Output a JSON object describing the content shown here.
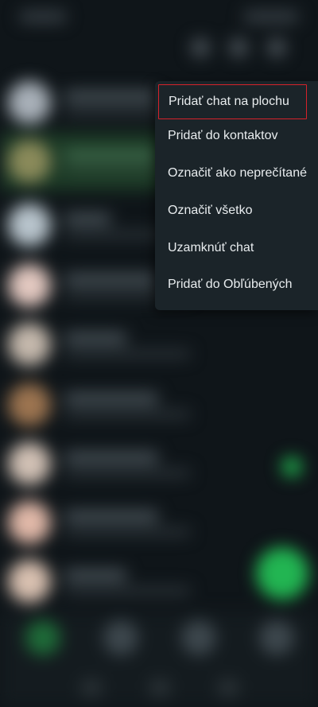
{
  "context_menu": {
    "items": [
      {
        "label": "Pridať chat na plochu"
      },
      {
        "label": "Pridať do kontaktov"
      },
      {
        "label": "Označiť ako neprečítané"
      },
      {
        "label": "Označiť všetko"
      },
      {
        "label": "Uzamknúť chat"
      },
      {
        "label": "Pridať do Obľúbených"
      }
    ]
  },
  "colors": {
    "menu_background": "#1b2429",
    "menu_text": "#e9edef",
    "highlight_outline": "#d6222a",
    "accent_green": "#22b552",
    "selected_row": "#1c3a26"
  }
}
